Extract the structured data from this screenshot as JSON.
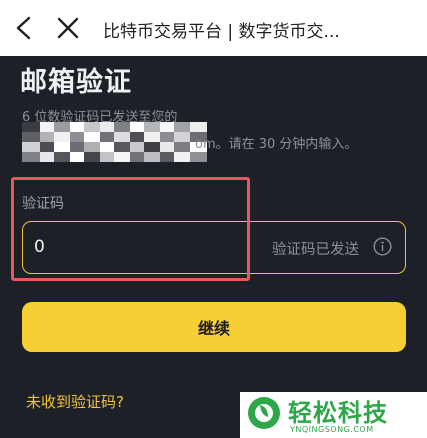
{
  "header": {
    "title": "比特币交易平台 | 数字货币交...",
    "back_icon": "back-arrow-icon",
    "close_icon": "close-icon"
  },
  "page": {
    "heading": "邮箱验证",
    "desc_line1": "6 位数验证码已发送至您的",
    "desc_line2": "om。请在 30 分钟内输入。"
  },
  "form": {
    "code_label": "验证码",
    "code_value": "0",
    "sent_status": "验证码已发送",
    "info_icon": "info-icon"
  },
  "actions": {
    "continue_label": "继续",
    "resend_label": "未收到验证码?"
  },
  "watermark": {
    "text": "轻松科技",
    "sub": "YNQINGSONG.COM"
  },
  "colors": {
    "background": "#1e2027",
    "accent": "#f5cf33",
    "highlight": "#e35a5f",
    "watermark": "#2ea74a"
  }
}
